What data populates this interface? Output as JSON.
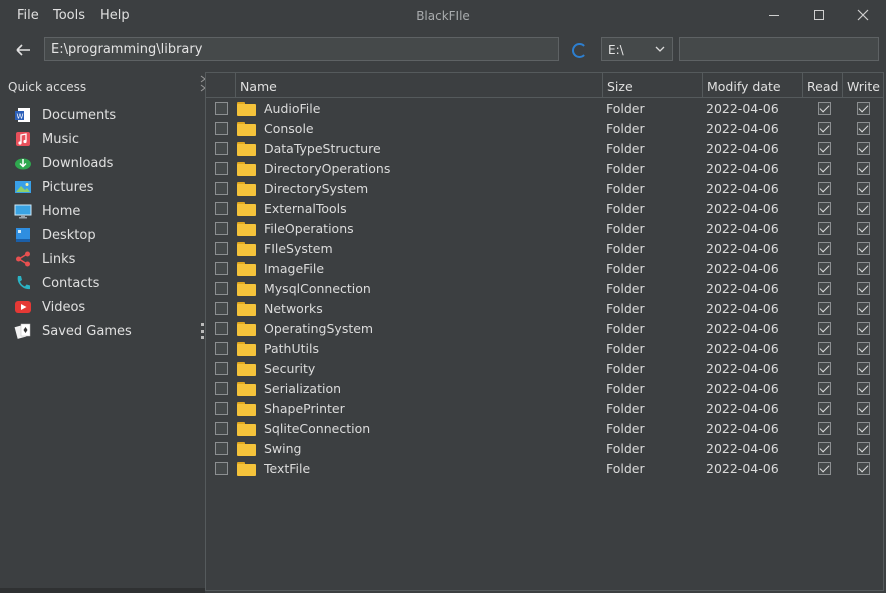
{
  "app": {
    "title": "BlackFIle",
    "menu": [
      "File",
      "Tools",
      "Help"
    ]
  },
  "address": {
    "path": "E:\\programming\\library",
    "drive": "E:\\",
    "search_value": ""
  },
  "sidebar": {
    "title": "Quick access",
    "items": [
      {
        "label": "Documents",
        "icon": "word-document-icon"
      },
      {
        "label": "Music",
        "icon": "music-icon"
      },
      {
        "label": "Downloads",
        "icon": "downloads-icon"
      },
      {
        "label": "Pictures",
        "icon": "pictures-icon"
      },
      {
        "label": "Home",
        "icon": "monitor-icon"
      },
      {
        "label": "Desktop",
        "icon": "desktop-icon"
      },
      {
        "label": "Links",
        "icon": "share-icon"
      },
      {
        "label": "Contacts",
        "icon": "phone-icon"
      },
      {
        "label": "Videos",
        "icon": "play-icon"
      },
      {
        "label": "Saved Games",
        "icon": "cards-icon"
      }
    ]
  },
  "table": {
    "columns": {
      "name": "Name",
      "size": "Size",
      "modify": "Modify date",
      "read": "Read",
      "write": "Write"
    },
    "rows": [
      {
        "name": "AudioFile",
        "size": "Folder",
        "date": "2022-04-06",
        "read": true,
        "write": true
      },
      {
        "name": "Console",
        "size": "Folder",
        "date": "2022-04-06",
        "read": true,
        "write": true
      },
      {
        "name": "DataTypeStructure",
        "size": "Folder",
        "date": "2022-04-06",
        "read": true,
        "write": true
      },
      {
        "name": "DirectoryOperations",
        "size": "Folder",
        "date": "2022-04-06",
        "read": true,
        "write": true
      },
      {
        "name": "DirectorySystem",
        "size": "Folder",
        "date": "2022-04-06",
        "read": true,
        "write": true
      },
      {
        "name": "ExternalTools",
        "size": "Folder",
        "date": "2022-04-06",
        "read": true,
        "write": true
      },
      {
        "name": "FileOperations",
        "size": "Folder",
        "date": "2022-04-06",
        "read": true,
        "write": true
      },
      {
        "name": "FIleSystem",
        "size": "Folder",
        "date": "2022-04-06",
        "read": true,
        "write": true
      },
      {
        "name": "ImageFile",
        "size": "Folder",
        "date": "2022-04-06",
        "read": true,
        "write": true
      },
      {
        "name": "MysqlConnection",
        "size": "Folder",
        "date": "2022-04-06",
        "read": true,
        "write": true
      },
      {
        "name": "Networks",
        "size": "Folder",
        "date": "2022-04-06",
        "read": true,
        "write": true
      },
      {
        "name": "OperatingSystem",
        "size": "Folder",
        "date": "2022-04-06",
        "read": true,
        "write": true
      },
      {
        "name": "PathUtils",
        "size": "Folder",
        "date": "2022-04-06",
        "read": true,
        "write": true
      },
      {
        "name": "Security",
        "size": "Folder",
        "date": "2022-04-06",
        "read": true,
        "write": true
      },
      {
        "name": "Serialization",
        "size": "Folder",
        "date": "2022-04-06",
        "read": true,
        "write": true
      },
      {
        "name": "ShapePrinter",
        "size": "Folder",
        "date": "2022-04-06",
        "read": true,
        "write": true
      },
      {
        "name": "SqliteConnection",
        "size": "Folder",
        "date": "2022-04-06",
        "read": true,
        "write": true
      },
      {
        "name": "Swing",
        "size": "Folder",
        "date": "2022-04-06",
        "read": true,
        "write": true
      },
      {
        "name": "TextFile",
        "size": "Folder",
        "date": "2022-04-06",
        "read": true,
        "write": true
      }
    ]
  },
  "colors": {
    "background": "#3c3f41",
    "field": "#45494a",
    "border": "#555a5c",
    "folder": "#f5c33b",
    "accent": "#2d7fd0"
  }
}
